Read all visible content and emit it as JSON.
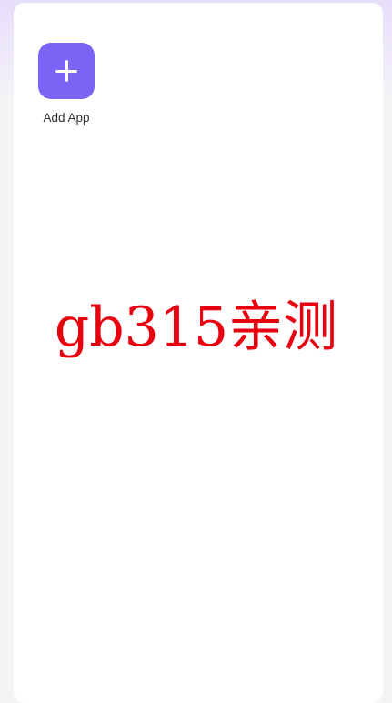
{
  "add_app": {
    "label": "Add App",
    "icon": "plus-icon",
    "tile_color": "#7c63f6"
  },
  "watermark": {
    "text": "gb315亲测",
    "color": "#e8000e"
  }
}
